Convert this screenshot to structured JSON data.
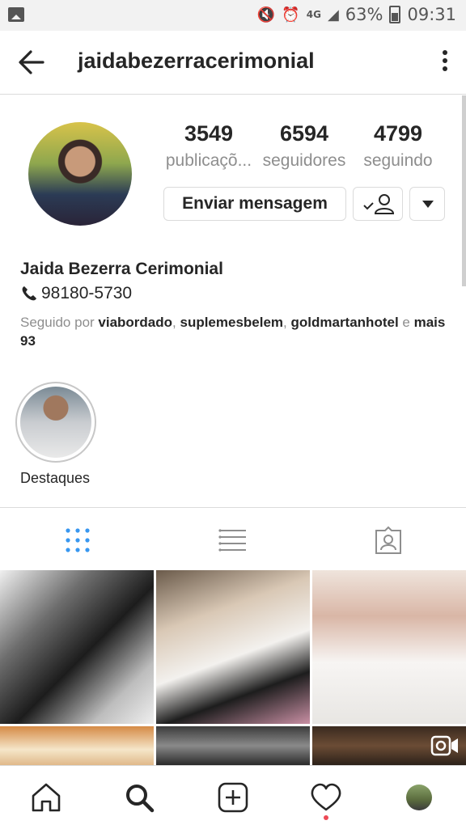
{
  "status_bar": {
    "network": "4G",
    "battery_percent": "63%",
    "time": "09:31"
  },
  "header": {
    "username": "jaidabezerracerimonial"
  },
  "profile": {
    "stats": [
      {
        "value": "3549",
        "label": "publicaçõ..."
      },
      {
        "value": "6594",
        "label": "seguidores"
      },
      {
        "value": "4799",
        "label": "seguindo"
      }
    ],
    "message_button": "Enviar mensagem",
    "name": "Jaida Bezerra Cerimonial",
    "phone": "98180-5730",
    "followed_by_prefix": "Seguido por ",
    "followed_users": [
      "viabordado",
      "suplemesbelem",
      "goldmartanhotel"
    ],
    "followed_by_joiner": " e ",
    "followed_by_more": "mais 93"
  },
  "highlights": [
    {
      "label": "Destaques"
    }
  ],
  "tabs": [
    "grid",
    "list",
    "tagged"
  ],
  "active_tab": "grid",
  "posts": [
    {
      "type": "photo"
    },
    {
      "type": "photo"
    },
    {
      "type": "photo"
    },
    {
      "type": "photo"
    },
    {
      "type": "photo"
    },
    {
      "type": "video"
    }
  ],
  "colors": {
    "accent": "#3897f0",
    "text": "#262626",
    "muted": "#8e8e8e",
    "border": "#dbdbdb",
    "notification": "#ed4956"
  },
  "icons": {
    "back": "arrow-left",
    "more": "vertical-ellipsis",
    "nav": [
      "home",
      "search",
      "add",
      "heart",
      "profile-avatar"
    ]
  }
}
